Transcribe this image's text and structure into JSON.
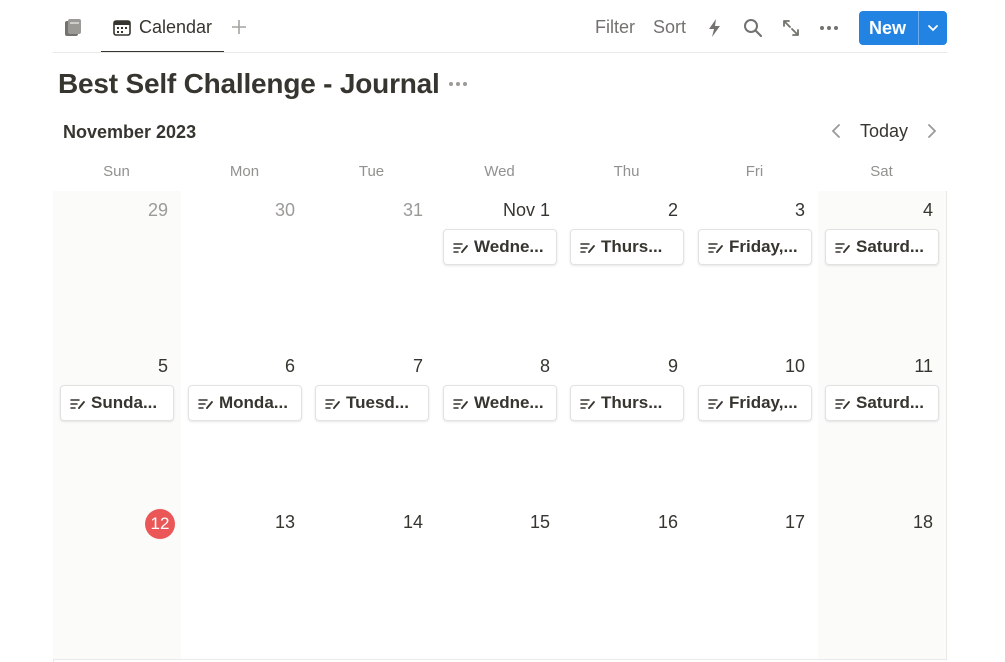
{
  "view_tabs": [
    {
      "label": "Calendar"
    }
  ],
  "toolbar": {
    "filter_label": "Filter",
    "sort_label": "Sort",
    "new_label": "New"
  },
  "page": {
    "title": "Best Self Challenge - Journal"
  },
  "calendar": {
    "month_label": "November 2023",
    "today_label": "Today",
    "weekdays": [
      "Sun",
      "Mon",
      "Tue",
      "Wed",
      "Thu",
      "Fri",
      "Sat"
    ],
    "weeks": [
      [
        {
          "day": "29",
          "muted": true,
          "entry": null
        },
        {
          "day": "30",
          "muted": true,
          "entry": null
        },
        {
          "day": "31",
          "muted": true,
          "entry": null
        },
        {
          "day": "Nov 1",
          "muted": false,
          "entry": "Wedne..."
        },
        {
          "day": "2",
          "muted": false,
          "entry": "Thurs..."
        },
        {
          "day": "3",
          "muted": false,
          "entry": "Friday,..."
        },
        {
          "day": "4",
          "muted": false,
          "entry": "Saturd..."
        }
      ],
      [
        {
          "day": "5",
          "muted": false,
          "entry": "Sunda..."
        },
        {
          "day": "6",
          "muted": false,
          "entry": "Monda..."
        },
        {
          "day": "7",
          "muted": false,
          "entry": "Tuesd..."
        },
        {
          "day": "8",
          "muted": false,
          "entry": "Wedne..."
        },
        {
          "day": "9",
          "muted": false,
          "entry": "Thurs..."
        },
        {
          "day": "10",
          "muted": false,
          "entry": "Friday,..."
        },
        {
          "day": "11",
          "muted": false,
          "entry": "Saturd..."
        }
      ],
      [
        {
          "day": "12",
          "muted": false,
          "today": true,
          "entry": null
        },
        {
          "day": "13",
          "muted": false,
          "entry": null
        },
        {
          "day": "14",
          "muted": false,
          "entry": null
        },
        {
          "day": "15",
          "muted": false,
          "entry": null
        },
        {
          "day": "16",
          "muted": false,
          "entry": null
        },
        {
          "day": "17",
          "muted": false,
          "entry": null
        },
        {
          "day": "18",
          "muted": false,
          "entry": null
        }
      ]
    ]
  },
  "colors": {
    "accent": "#2383e2",
    "today": "#eb5757",
    "text": "#37352f",
    "muted": "#9b9a97"
  },
  "icons": {
    "database": "database-icon",
    "calendar_tab": "calendar-icon",
    "add_view": "plus-icon",
    "automation": "lightning-icon",
    "search": "search-icon",
    "expand": "expand-icon",
    "more": "more-icon",
    "dropdown": "chevron-down-icon",
    "prev": "chevron-left-icon",
    "next": "chevron-right-icon",
    "entry": "page-edit-icon"
  }
}
